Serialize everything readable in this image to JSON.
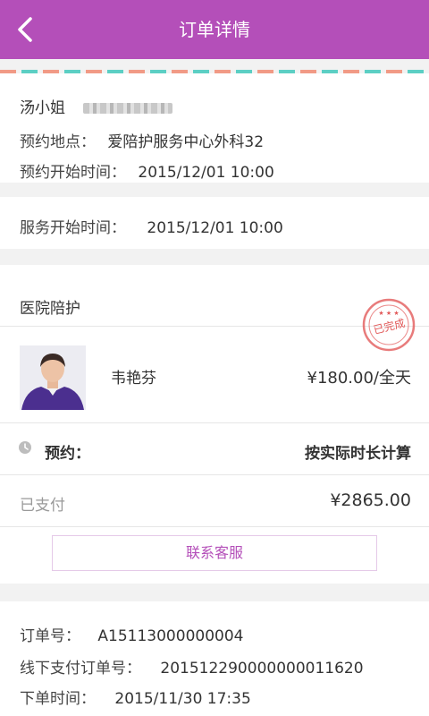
{
  "header": {
    "title": "订单详情",
    "back_icon": "chevron-left-icon",
    "color": "#b44fb9"
  },
  "customer": {
    "name": "汤小姐",
    "location_label": "预约地点：",
    "location": "爱陪护服务中心外科32",
    "start_label": "预约开始时间：",
    "start_time": "2015/12/01 10:00"
  },
  "service": {
    "label": "服务开始时间：",
    "time": "2015/12/01 10:00"
  },
  "care": {
    "section_title": "医院陪护",
    "nurse_name": "韦艳芬",
    "price": "¥180.00/全天",
    "stamp_text": "已完成",
    "booking_label": "预约：",
    "booking_value": "按实际时长计算",
    "paid_label": "已支付",
    "paid_amount": "¥2865.00",
    "contact_button": "联系客服"
  },
  "order": {
    "order_no_label": "订单号：",
    "order_no": "A15113000000004",
    "offline_no_label": "线下支付订单号：",
    "offline_no": "201512290000000011620",
    "order_time_label": "下单时间：",
    "order_time": "2015/11/30 17:35"
  },
  "colors": {
    "accent": "#b44fb9",
    "stamp": "#e25a5a",
    "stripe_a": "#f19a86",
    "stripe_b": "#5ccfc4"
  }
}
